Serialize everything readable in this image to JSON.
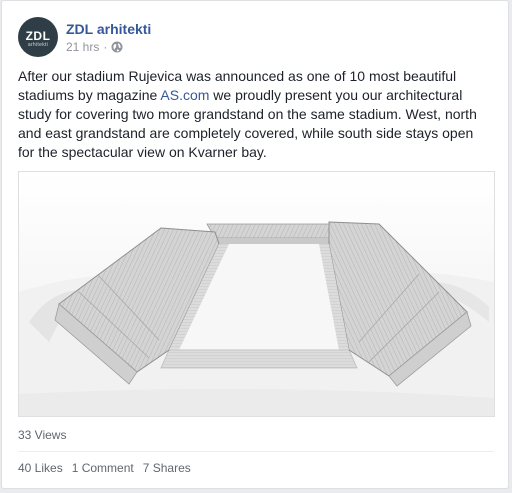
{
  "post": {
    "author": "ZDL arhitekti",
    "avatar_text": "ZDL",
    "avatar_subtext": "arhitekti",
    "timestamp": "21 hrs",
    "separator": "·",
    "privacy_icon": "globe-icon",
    "text_part1": "After our stadium Rujevica was announced as one of 10 most beautiful stadiums by magazine ",
    "text_link": "AS.com",
    "text_part2": " we proudly present you our architectural study for covering two more grandstand on the same stadium. West, north and east grandstand are completely covered, while south side stays open for the spectacular view on Kvarner bay."
  },
  "stats": {
    "views": "33 Views",
    "likes": "40 Likes",
    "comments": "1 Comment",
    "shares": "7 Shares"
  },
  "colors": {
    "link": "#365899",
    "meta": "#90949c",
    "avatar_bg": "#2f3e46"
  }
}
